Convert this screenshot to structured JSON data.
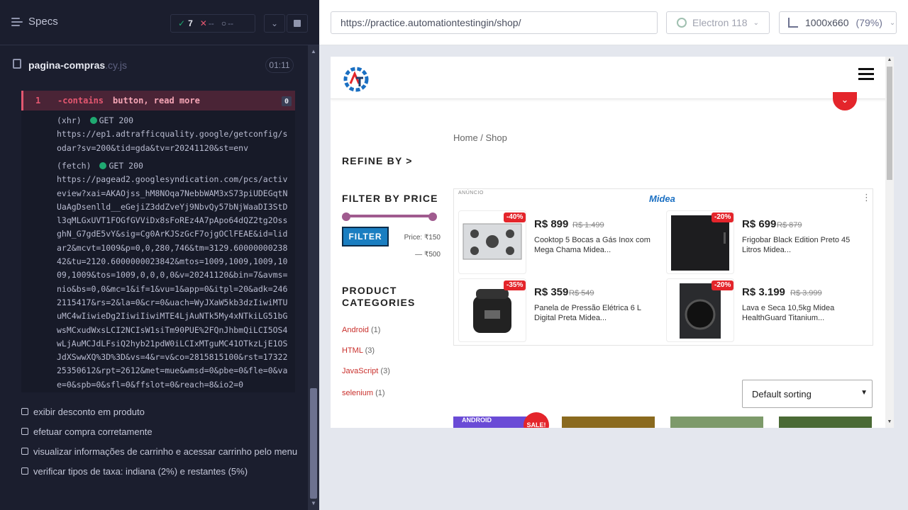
{
  "reporter": {
    "title": "Specs",
    "stats": {
      "passed": "7",
      "failed": "--",
      "pending": "--"
    },
    "spec_file": {
      "name": "pagina-compras",
      "ext": ".cy.js",
      "duration": "01:11"
    },
    "failed_command": {
      "number": "1",
      "name": "-contains",
      "args": "button, read more",
      "count": "0"
    },
    "log": [
      {
        "kind": "(xhr)",
        "method": "GET 200",
        "url": "https://ep1.adtrafficquality.google/getconfig/sodar?sv=200&tid=gda&tv=r20241120&st=env"
      },
      {
        "kind": "(fetch)",
        "method": "GET 200",
        "url": "https://pagead2.googlesyndication.com/pcs/activeview?xai=AKAOjss_hM8NOqa7NebbWAM3xS73piUDEGqtNUaAgDsenlld__eGejiZ3ddZveYj9NbvQy57bNjWaaDI3StDl3qMLGxUVT1FOGfGVViDx8sFoREz4A7pApo64dQZ2tg2OssghN_G7gdE5vY&sig=Cg0ArKJSzGcF7ojgOClFEAE&id=lidar2&mcvt=1009&p=0,0,280,746&tm=3129.6000000023842&tu=2120.6000000023842&mtos=1009,1009,1009,1009,1009&tos=1009,0,0,0,0&v=20241120&bin=7&avms=nio&bs=0,0&mc=1&if=1&vu=1&app=0&itpl=20&adk=2462115417&rs=2&la=0&cr=0&uach=WyJXaW5kb3dzIiwiMTUuMC4wIiwieDg2IiwiIiwiMTE4LjAuNTk5My4xNTkiLG51bGwsMCxudWxsLCI2NCIsW1siTm90PUE%2FQnJhbmQiLCI5OS4wLjAuMCJdLFsiQ2hyb21pdW0iLCIxMTguMC41OTkzLjE1OSJdXSwwXQ%3D%3D&vs=4&r=v&co=2815815100&rst=1732225350612&rpt=2612&met=mue&wmsd=0&pbe=0&fle=0&vae=0&spb=0&sfl=0&ffslot=0&reach=8&io2=0"
      }
    ],
    "tests": [
      "exibir desconto em produto",
      "efetuar compra corretamente",
      "visualizar informações de carrinho e acessar carrinho pelo menu",
      "verificar tipos de taxa: indiana (2%) e restantes (5%)"
    ]
  },
  "aut": {
    "url": "https://practice.automationtestingin/shop/",
    "browser": "Electron 118",
    "viewport": "1000x660",
    "zoom": "(79%)"
  },
  "site": {
    "breadcrumb": "Home / Shop",
    "refine_by": "REFINE BY >",
    "filter_by_price": "FILTER BY PRICE",
    "filter_button": "FILTER",
    "price_label": "Price: ₹150 — ₹500",
    "product_categories": "PRODUCT CATEGORIES",
    "categories": [
      {
        "name": "Android",
        "count": "(1)"
      },
      {
        "name": "HTML",
        "count": "(3)"
      },
      {
        "name": "JavaScript",
        "count": "(3)"
      },
      {
        "name": "selenium",
        "count": "(1)"
      }
    ],
    "ad": {
      "label": "ANÚNCIO",
      "brand": "Midea",
      "products": [
        {
          "discount": "-40%",
          "price": "R$ 899",
          "old_price": "R$ 1.499",
          "name": "Cooktop 5 Bocas a Gás Inox com Mega Chama Midea..."
        },
        {
          "discount": "-20%",
          "price": "R$ 699",
          "old_price": "R$ 879",
          "name": "Frigobar Black Edition Preto 45 Litros Midea..."
        },
        {
          "discount": "-35%",
          "price": "R$ 359",
          "old_price": "R$ 549",
          "name": "Panela de Pressão Elétrica 6 L Digital Preta Midea..."
        },
        {
          "discount": "-20%",
          "price": "R$ 3.199",
          "old_price": "R$ 3.999",
          "name": "Lava e Seca 10,5kg Midea HealthGuard Titanium..."
        }
      ]
    },
    "sorting": "Default sorting",
    "sale_badge": "SALE!",
    "tile_text": "ANDROID"
  },
  "colors": {
    "reporter_bg": "#1b1e2e",
    "pass": "#1fa971",
    "fail": "#e45770",
    "accent_red": "#e4252b",
    "filter_blue": "#1a7ec1"
  }
}
